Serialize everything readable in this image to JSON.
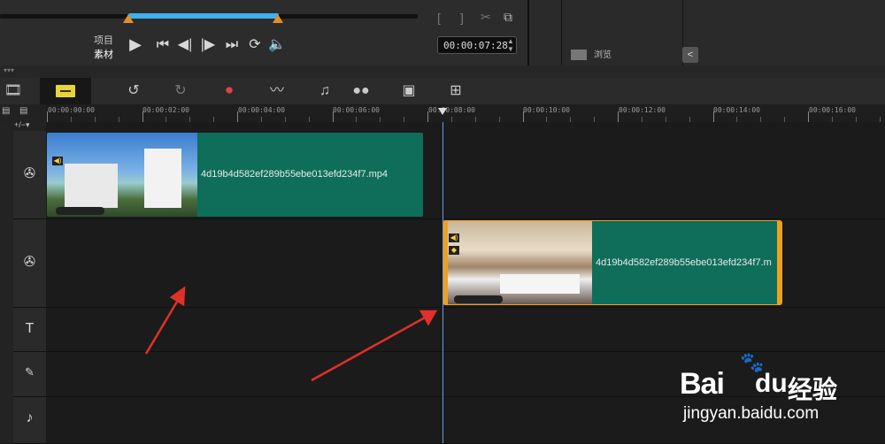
{
  "player": {
    "mode_project": "项目",
    "mode_clip": "素材",
    "timecode": "00:00:07:28",
    "controls": [
      "play",
      "to-start",
      "prev-frame",
      "next-frame",
      "to-end",
      "repeat",
      "volume"
    ]
  },
  "browser": {
    "browse_label": "浏览",
    "collapse_glyph": "<"
  },
  "toolbar": {
    "buttons": [
      "storyboard-view",
      "timeline-view",
      "undo",
      "redo",
      "record-capture",
      "sound-mixer",
      "auto-music",
      "motion-tracking",
      "title",
      "multicam"
    ]
  },
  "ruler": {
    "labels": [
      "00:00:00:00",
      "00:00:02:00",
      "00:00:04:00",
      "00:00:06:00",
      "00:00:08:00",
      "00:00:10:00",
      "00:00:12:00",
      "00:00:14:00",
      "00:00:16:00"
    ]
  },
  "tracks": {
    "video_clip_1": "4d19b4d582ef289b55ebe013efd234f7.mp4",
    "overlay_clip_1": "4d19b4d582ef289b55ebe013efd234f7.m"
  },
  "watermark": {
    "brand": "Bai",
    "brand_suffix": "经验",
    "url": "jingyan.baidu.com"
  },
  "colors": {
    "clip": "#0e6e5a",
    "selection": "#f0a020",
    "scrub": "#3fb0ee",
    "playhead": "#6a9fe0"
  }
}
